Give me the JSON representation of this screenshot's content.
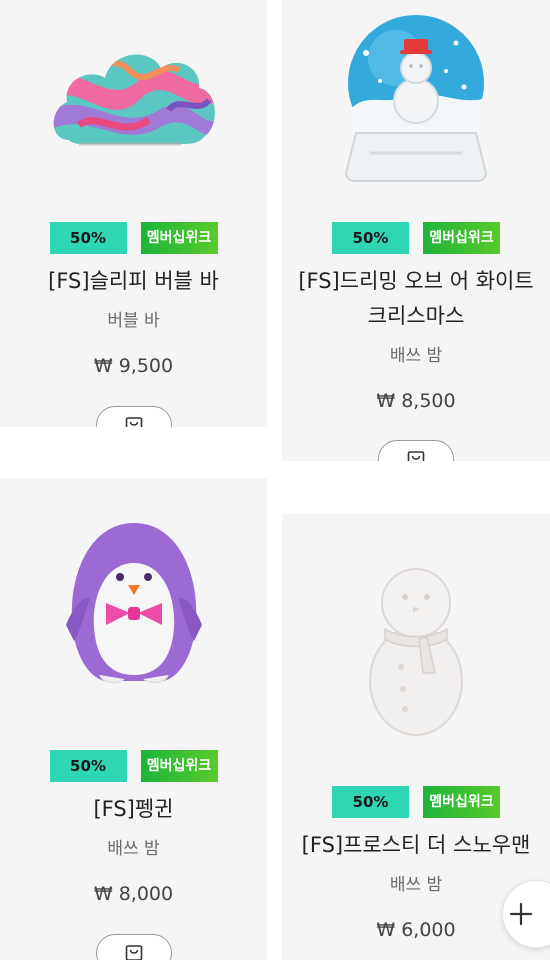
{
  "currency_symbol": "₩",
  "products": [
    {
      "name": "[FS]슬리피 버블 바",
      "category": "버블 바",
      "price": "₩ 9,500",
      "sale_badge": "50%",
      "member_badge": "멤버십위크",
      "image_icon": "cloud-bubble-bar-icon"
    },
    {
      "name": "[FS]드리밍 오브 어 화이트 크리스마스",
      "category": "배쓰 밤",
      "price": "₩ 8,500",
      "sale_badge": "50%",
      "member_badge": "멤버십위크",
      "image_icon": "snow-globe-bath-bomb-icon"
    },
    {
      "name": "[FS]펭귄",
      "category": "배쓰 밤",
      "price": "₩ 8,000",
      "sale_badge": "50%",
      "member_badge": "멤버십위크",
      "image_icon": "penguin-bath-bomb-icon"
    },
    {
      "name": "[FS]프로스티 더 스노우맨",
      "category": "배쓰 밤",
      "price": "₩ 6,000",
      "sale_badge": "50%",
      "member_badge": "멤버십위크",
      "image_icon": "snowman-bath-bomb-icon"
    }
  ],
  "icons": {
    "cart": "shopping-bag-icon",
    "fab": "plus-icon"
  },
  "colors": {
    "sale_badge": "#2fd6b3",
    "member_badge": "#1eb53a",
    "card_bg": "#f5f5f5"
  }
}
